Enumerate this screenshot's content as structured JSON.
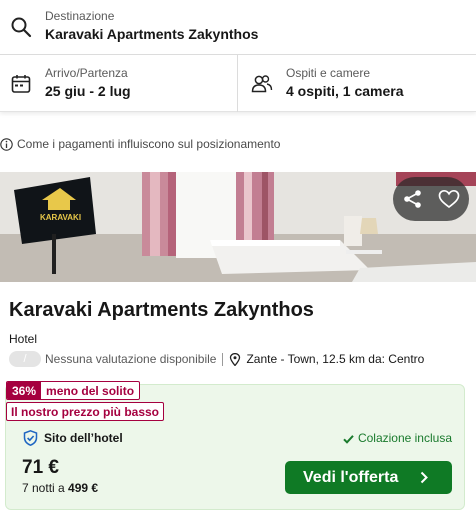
{
  "search": {
    "destination_label": "Destinazione",
    "destination_value": "Karavaki Apartments Zakynthos",
    "dates_label": "Arrivo/Partenza",
    "dates_value": "25 giu - 2 lug",
    "guests_label": "Ospiti e camere",
    "guests_value": "4 ospiti, 1 camera"
  },
  "info": {
    "text": "Come i pagamenti influiscono sul posizionamento"
  },
  "hotel": {
    "name": "Karavaki Apartments Zakynthos",
    "type": "Hotel",
    "rating_pill": "/",
    "rating_text": "Nessuna valutazione disponibile",
    "location": "Zante - Town, 12.5 km da: Centro",
    "image_logo_text": "KARAVAKI"
  },
  "deal": {
    "discount_pct": "36%",
    "discount_text": "meno del solito",
    "best_price": "Il nostro prezzo più basso",
    "provider": "Sito dell’hotel",
    "breakfast": "Colazione inclusa",
    "price": "71 €",
    "nights_prefix": "7 notti a",
    "total": "499 €",
    "cta": "Vedi l'offerta"
  },
  "icons": {
    "search": "search-icon",
    "calendar": "calendar-icon",
    "guests": "people-icon",
    "info": "info-icon",
    "share": "share-icon",
    "favorite": "heart-icon",
    "pin": "map-pin-icon",
    "shield": "shield-check-icon",
    "check": "check-icon",
    "chevron": "chevron-right-icon"
  },
  "colors": {
    "accent_green": "#0f7a25",
    "deal_bg": "#edf7ea",
    "badge_red": "#a5003f"
  }
}
